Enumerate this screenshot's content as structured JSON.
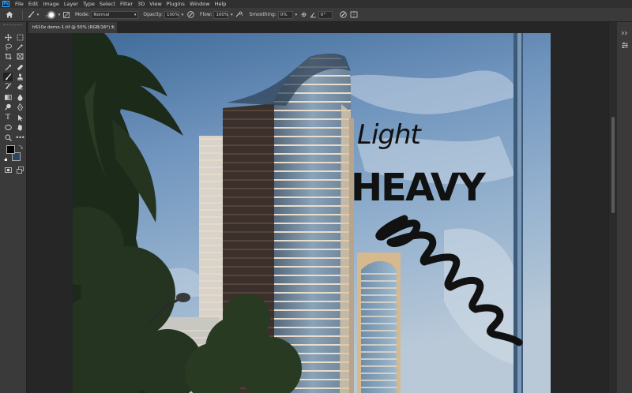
{
  "app": {
    "logo_text": "Ps"
  },
  "menu": [
    "File",
    "Edit",
    "Image",
    "Layer",
    "Type",
    "Select",
    "Filter",
    "3D",
    "View",
    "Plugins",
    "Window",
    "Help"
  ],
  "options_bar": {
    "brush_size": "77",
    "mode_label": "Mode:",
    "mode_value": "Normal",
    "opacity_label": "Opacity:",
    "opacity_value": "100%",
    "flow_label": "Flow:",
    "flow_value": "100%",
    "smoothing_label": "Smoothing:",
    "smoothing_value": "0%",
    "angle_value": "0°"
  },
  "document": {
    "tab_title": "h610x demo-1.tif @ 50% (RGB/16*) *",
    "close_glyph": "×"
  },
  "canvas_text": {
    "light": "Light",
    "heavy": "HEAVY"
  },
  "colors": {
    "foreground": "#000000",
    "background": "#2b4462",
    "accent": "#31a8ff"
  },
  "tools": [
    "move-tool",
    "marquee-tool",
    "lasso-tool",
    "magic-wand-tool",
    "crop-tool",
    "frame-tool",
    "eyedropper-tool",
    "healing-brush-tool",
    "brush-tool",
    "clone-stamp-tool",
    "history-brush-tool",
    "eraser-tool",
    "gradient-tool",
    "blur-tool",
    "dodge-tool",
    "pen-tool",
    "type-tool",
    "path-selection-tool",
    "rectangle-tool",
    "hand-tool",
    "zoom-tool",
    "more-tools"
  ]
}
